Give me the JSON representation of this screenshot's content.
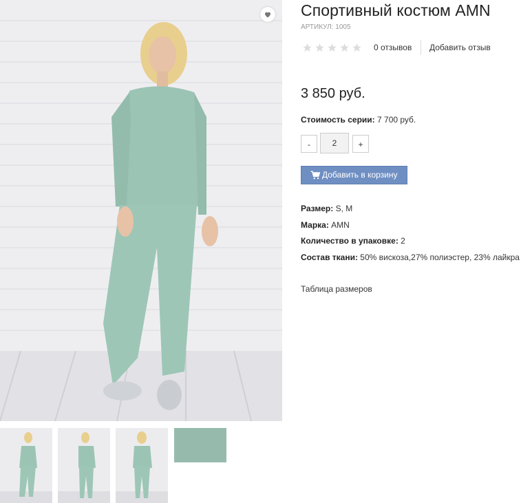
{
  "product": {
    "title": "Спортивный костюм AMN",
    "sku": "АРТИКУЛ: 1005",
    "rating": {
      "stars": 0,
      "max": 5
    },
    "reviews_count": "0 отзывов",
    "add_review": "Добавить отзыв",
    "price": "3 850 руб.",
    "series_label": "Стоимость серии:",
    "series_value": "7 700 руб.",
    "quantity": "2",
    "qty_minus": "-",
    "qty_plus": "+",
    "add_to_cart": "Добавить в корзину",
    "props": [
      {
        "label": "Размер:",
        "value": "S, M"
      },
      {
        "label": "Марка:",
        "value": "AMN"
      },
      {
        "label": "Количество в упаковке:",
        "value": "2"
      },
      {
        "label": "Состав ткани:",
        "value": "50% вискоза,27% полиэстер, 23% лайкра"
      }
    ],
    "size_table": "Таблица размеров"
  },
  "colors": {
    "accent": "#6f8fc3",
    "garment": "#9cc4b4",
    "star_empty": "#dcdcdc"
  },
  "icons": [
    "heart-icon",
    "star-icon",
    "cart-icon"
  ]
}
